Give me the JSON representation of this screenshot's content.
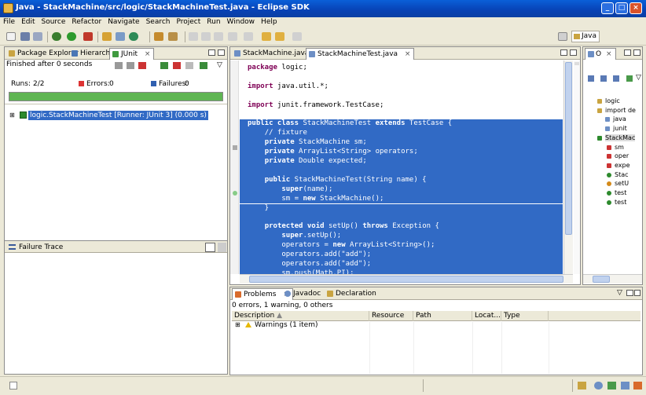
{
  "window": {
    "title": "Java - StackMachine/src/logic/StackMachineTest.java - Eclipse SDK",
    "minimize": "_",
    "maximize": "□",
    "close": "×"
  },
  "menu": [
    "File",
    "Edit",
    "Source",
    "Refactor",
    "Navigate",
    "Search",
    "Project",
    "Run",
    "Window",
    "Help"
  ],
  "perspective": {
    "label": "Java"
  },
  "left_tabs": [
    {
      "label": "Package Explorer"
    },
    {
      "label": "Hierarchy"
    },
    {
      "label": "JUnit"
    }
  ],
  "junit": {
    "status": "Finished after 0 seconds",
    "runs_label": "Runs:",
    "runs_value": "2/2",
    "errors_label": "Errors:",
    "errors_value": "0",
    "failures_label": "Failures:",
    "failures_value": "0",
    "progress": 1.0,
    "progress_color": "#5fb553",
    "tree_item": "logic.StackMachineTest [Runner: JUnit 3] (0.000 s)",
    "failure_trace_label": "Failure Trace"
  },
  "editor": {
    "tabs": [
      {
        "label": "StackMachine.java"
      },
      {
        "label": "StackMachineTest.java"
      }
    ],
    "lines": [
      [
        [
          "kw",
          "package"
        ],
        [
          "t",
          " logic;"
        ]
      ],
      [
        [
          "t",
          ""
        ]
      ],
      [
        [
          "kw",
          "import"
        ],
        [
          "t",
          " java.util.*;"
        ]
      ],
      [
        [
          "t",
          ""
        ]
      ],
      [
        [
          "kw",
          "import"
        ],
        [
          "t",
          " junit.framework.TestCase;"
        ]
      ],
      [
        [
          "t",
          ""
        ]
      ],
      [
        [
          "kw",
          "public class"
        ],
        [
          "t",
          " StackMachineTest "
        ],
        [
          "kw",
          "extends"
        ],
        [
          "t",
          " TestCase {"
        ]
      ],
      [
        [
          "t",
          "    "
        ],
        [
          "cm",
          "// fixture"
        ]
      ],
      [
        [
          "t",
          "    "
        ],
        [
          "kw",
          "private"
        ],
        [
          "t",
          " StackMachine sm;"
        ]
      ],
      [
        [
          "t",
          "    "
        ],
        [
          "kw",
          "private"
        ],
        [
          "t",
          " ArrayList<String> operators;"
        ]
      ],
      [
        [
          "t",
          "    "
        ],
        [
          "kw",
          "private"
        ],
        [
          "t",
          " Double expected;"
        ]
      ],
      [
        [
          "t",
          ""
        ]
      ],
      [
        [
          "t",
          "    "
        ],
        [
          "kw",
          "public"
        ],
        [
          "t",
          " StackMachineTest(String name) {"
        ]
      ],
      [
        [
          "t",
          "        "
        ],
        [
          "kw",
          "super"
        ],
        [
          "t",
          "(name);"
        ]
      ],
      [
        [
          "t",
          "        sm = "
        ],
        [
          "kw",
          "new"
        ],
        [
          "t",
          " StackMachine();"
        ]
      ],
      [
        [
          "t",
          "    }"
        ]
      ],
      [
        [
          "t",
          ""
        ]
      ],
      [
        [
          "t",
          "    "
        ],
        [
          "kw",
          "protected void"
        ],
        [
          "t",
          " setUp() "
        ],
        [
          "kw",
          "throws"
        ],
        [
          "t",
          " Exception {"
        ]
      ],
      [
        [
          "t",
          "        "
        ],
        [
          "kw",
          "super"
        ],
        [
          "t",
          ".setUp();"
        ]
      ],
      [
        [
          "t",
          "        operators = "
        ],
        [
          "kw",
          "new"
        ],
        [
          "t",
          " ArrayList<String>();"
        ]
      ],
      [
        [
          "t",
          "        operators.add("
        ],
        [
          "str",
          "\"add\""
        ],
        [
          "t",
          ");"
        ]
      ],
      [
        [
          "t",
          "        operators.add("
        ],
        [
          "str",
          "\"add\""
        ],
        [
          "t",
          ");"
        ]
      ],
      [
        [
          "t",
          "        sm.push(Math."
        ],
        [
          "t",
          "PI"
        ],
        [
          "t",
          ");"
        ]
      ]
    ],
    "selection_start": 6,
    "selection_color": "#316ac5"
  },
  "outline": {
    "tab_label": "O",
    "items": [
      "logic",
      "import de",
      "java",
      "junit",
      "StackMac",
      "sm",
      "oper",
      "expe",
      "Stac",
      "setU",
      "test",
      "test"
    ]
  },
  "bottom": {
    "tabs": [
      {
        "label": "Problems"
      },
      {
        "label": "Javadoc"
      },
      {
        "label": "Declaration"
      }
    ],
    "summary": "0 errors, 1 warning, 0 others",
    "columns": [
      "Description",
      "Resource",
      "Path",
      "Locat...",
      "Type"
    ],
    "rows": [
      {
        "description": "Warnings (1 item)"
      }
    ]
  },
  "colors": {
    "accent": "#316ac5",
    "titlebar": "#0842b5",
    "chrome": "#ece9d8",
    "junit_green": "#5fb553"
  }
}
